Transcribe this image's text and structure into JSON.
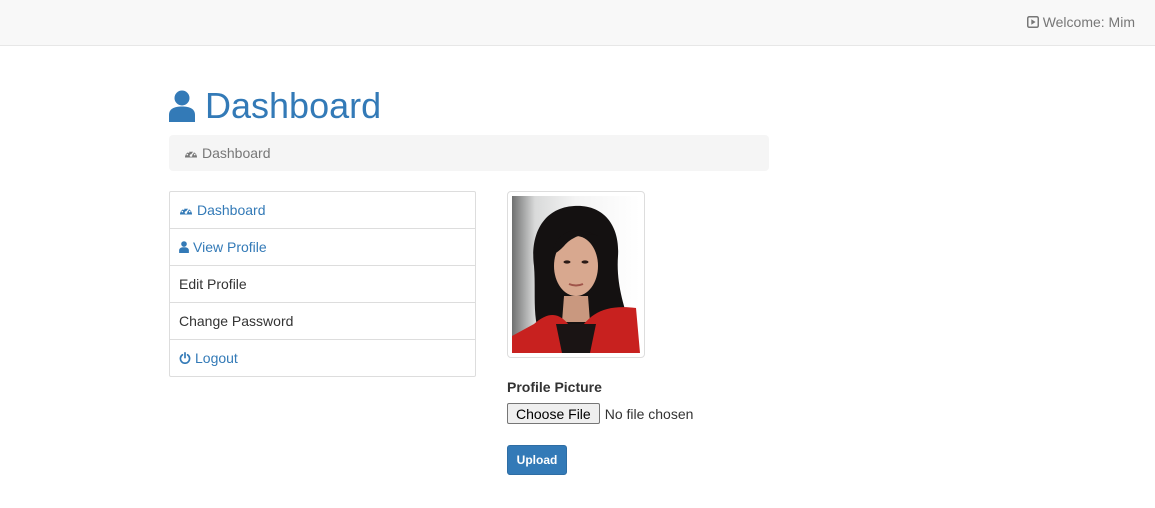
{
  "topbar": {
    "welcome_text": "Welcome: Mim",
    "welcome_icon": "play-square-icon"
  },
  "header": {
    "title": "Dashboard",
    "icon": "user-icon",
    "accent_color": "#337ab7"
  },
  "breadcrumb": {
    "label": "Dashboard",
    "icon": "dashboard-icon"
  },
  "sidebar": {
    "items": [
      {
        "label": "Dashboard",
        "icon": "dashboard-icon",
        "style": "link"
      },
      {
        "label": "View Profile",
        "icon": "user-icon",
        "style": "link"
      },
      {
        "label": "Edit Profile",
        "icon": "",
        "style": "plain"
      },
      {
        "label": "Change Password",
        "icon": "",
        "style": "plain"
      },
      {
        "label": "Logout",
        "icon": "power-icon",
        "style": "link"
      }
    ]
  },
  "profile": {
    "photo_alt": "profile-photo",
    "picture_label": "Profile Picture",
    "choose_file_label": "Choose File",
    "file_status": "No file chosen",
    "upload_label": "Upload"
  }
}
